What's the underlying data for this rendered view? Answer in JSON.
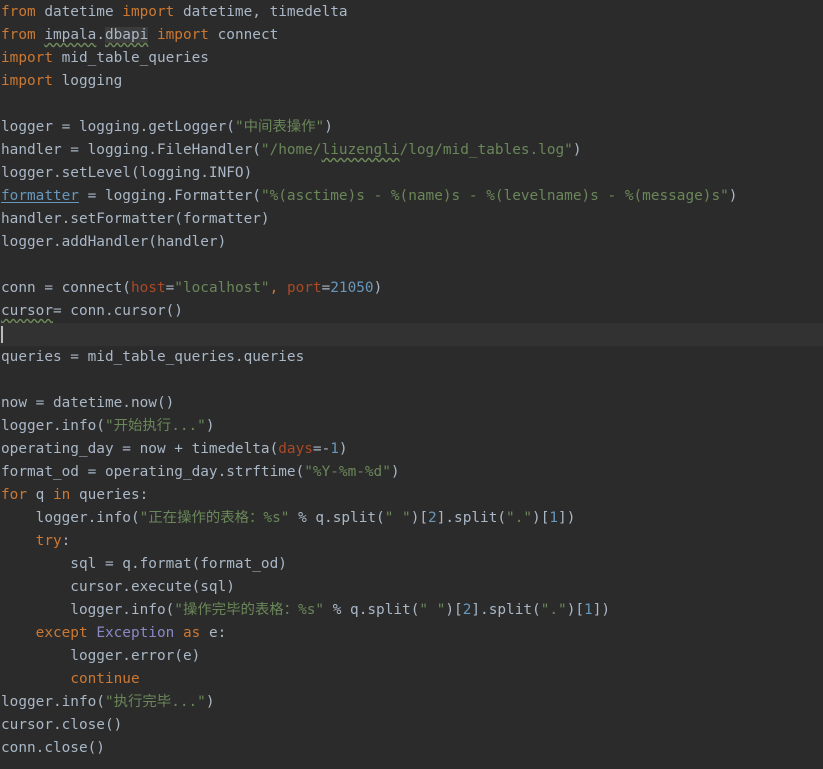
{
  "editor": {
    "language": "python",
    "theme": {
      "background": "#2b2b2b",
      "current_line": "#323232",
      "default_text": "#a9b7c6",
      "keyword": "#cc7832",
      "string": "#6a8759",
      "number": "#6897bb",
      "parameter": "#aa4926",
      "builtin": "#8888c6"
    },
    "lines": [
      [
        "from",
        " datetime ",
        "import",
        " datetime, timedelta"
      ],
      [
        "from",
        " ",
        "impala",
        ".",
        "dbapi",
        " ",
        "import",
        " connect"
      ],
      [
        "import",
        " mid_table_queries"
      ],
      [
        "import",
        " logging"
      ],
      [],
      [
        "logger = logging.getLogger(",
        "\"中间表操作\"",
        ")"
      ],
      [
        "handler = logging.FileHandler(",
        "\"/home/",
        "liuzengli",
        "/log/mid_tables.log\"",
        ")"
      ],
      [
        "logger.setLevel(logging.INFO)"
      ],
      [
        "formatter",
        " = logging.Formatter(",
        "\"%(asctime)s - %(name)s - %(levelname)s - %(message)s\"",
        ")"
      ],
      [
        "handler.setFormatter(formatter)"
      ],
      [
        "logger.addHandler(handler)"
      ],
      [],
      [
        "conn = connect(",
        "host",
        "=",
        "\"localhost\"",
        ", ",
        "port",
        "=",
        "21050",
        ")"
      ],
      [
        "cursor",
        "= conn.cursor()"
      ],
      [],
      [
        "queries = mid_table_queries.queries"
      ],
      [],
      [
        "now = datetime.now()"
      ],
      [
        "logger.info(",
        "\"开始执行...\"",
        ")"
      ],
      [
        "operating_day = now + timedelta(",
        "days",
        "=-",
        "1",
        ")"
      ],
      [
        "format_od = operating_day.strftime(",
        "\"%Y-%m-%d\"",
        ")"
      ],
      [
        "for",
        " q ",
        "in",
        " queries:"
      ],
      [
        "    logger.info(",
        "\"正在操作的表格：%s\"",
        " % q.split(",
        "\" \"",
        ")[",
        "2",
        "].split(",
        "\".\"",
        ")[",
        "1",
        "])"
      ],
      [
        "    ",
        "try",
        ":"
      ],
      [
        "        sql = q.format(format_od)"
      ],
      [
        "        cursor.execute(sql)"
      ],
      [
        "        logger.info(",
        "\"操作完毕的表格：%s\"",
        " % q.split(",
        "\" \"",
        ")[",
        "2",
        "].split(",
        "\".\"",
        ")[",
        "1",
        "])"
      ],
      [
        "    ",
        "except",
        " ",
        "Exception",
        " ",
        "as",
        " e:"
      ],
      [
        "        logger.error(e)"
      ],
      [
        "        ",
        "continue"
      ],
      [
        "logger.info(",
        "\"执行完毕...\"",
        ")"
      ],
      [
        "cursor.close()"
      ],
      [
        "conn.close()"
      ]
    ]
  }
}
